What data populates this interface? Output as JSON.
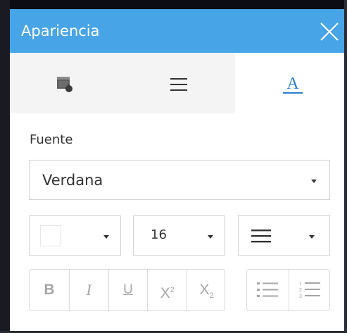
{
  "panel": {
    "title": "Apariencia",
    "header_color": "#47a4e6",
    "close_icon": "close-icon"
  },
  "tabs": [
    {
      "icon": "format-paint-icon",
      "active": false
    },
    {
      "icon": "align-lines-icon",
      "active": false
    },
    {
      "icon": "text-format-icon",
      "active": true
    }
  ],
  "font": {
    "label": "Fuente",
    "value": "Verdana"
  },
  "color_select": {
    "value": "#ffffff"
  },
  "size_select": {
    "value": "16"
  },
  "align_select": {
    "icon": "align-justify-icon"
  },
  "format_buttons": {
    "bold": "B",
    "italic": "I",
    "underline": "U",
    "superscript": "X",
    "superscript_mark": "2",
    "subscript": "X",
    "subscript_mark": "2"
  },
  "list_buttons": [
    {
      "icon": "bulleted-list-icon"
    },
    {
      "icon": "numbered-list-icon"
    }
  ]
}
